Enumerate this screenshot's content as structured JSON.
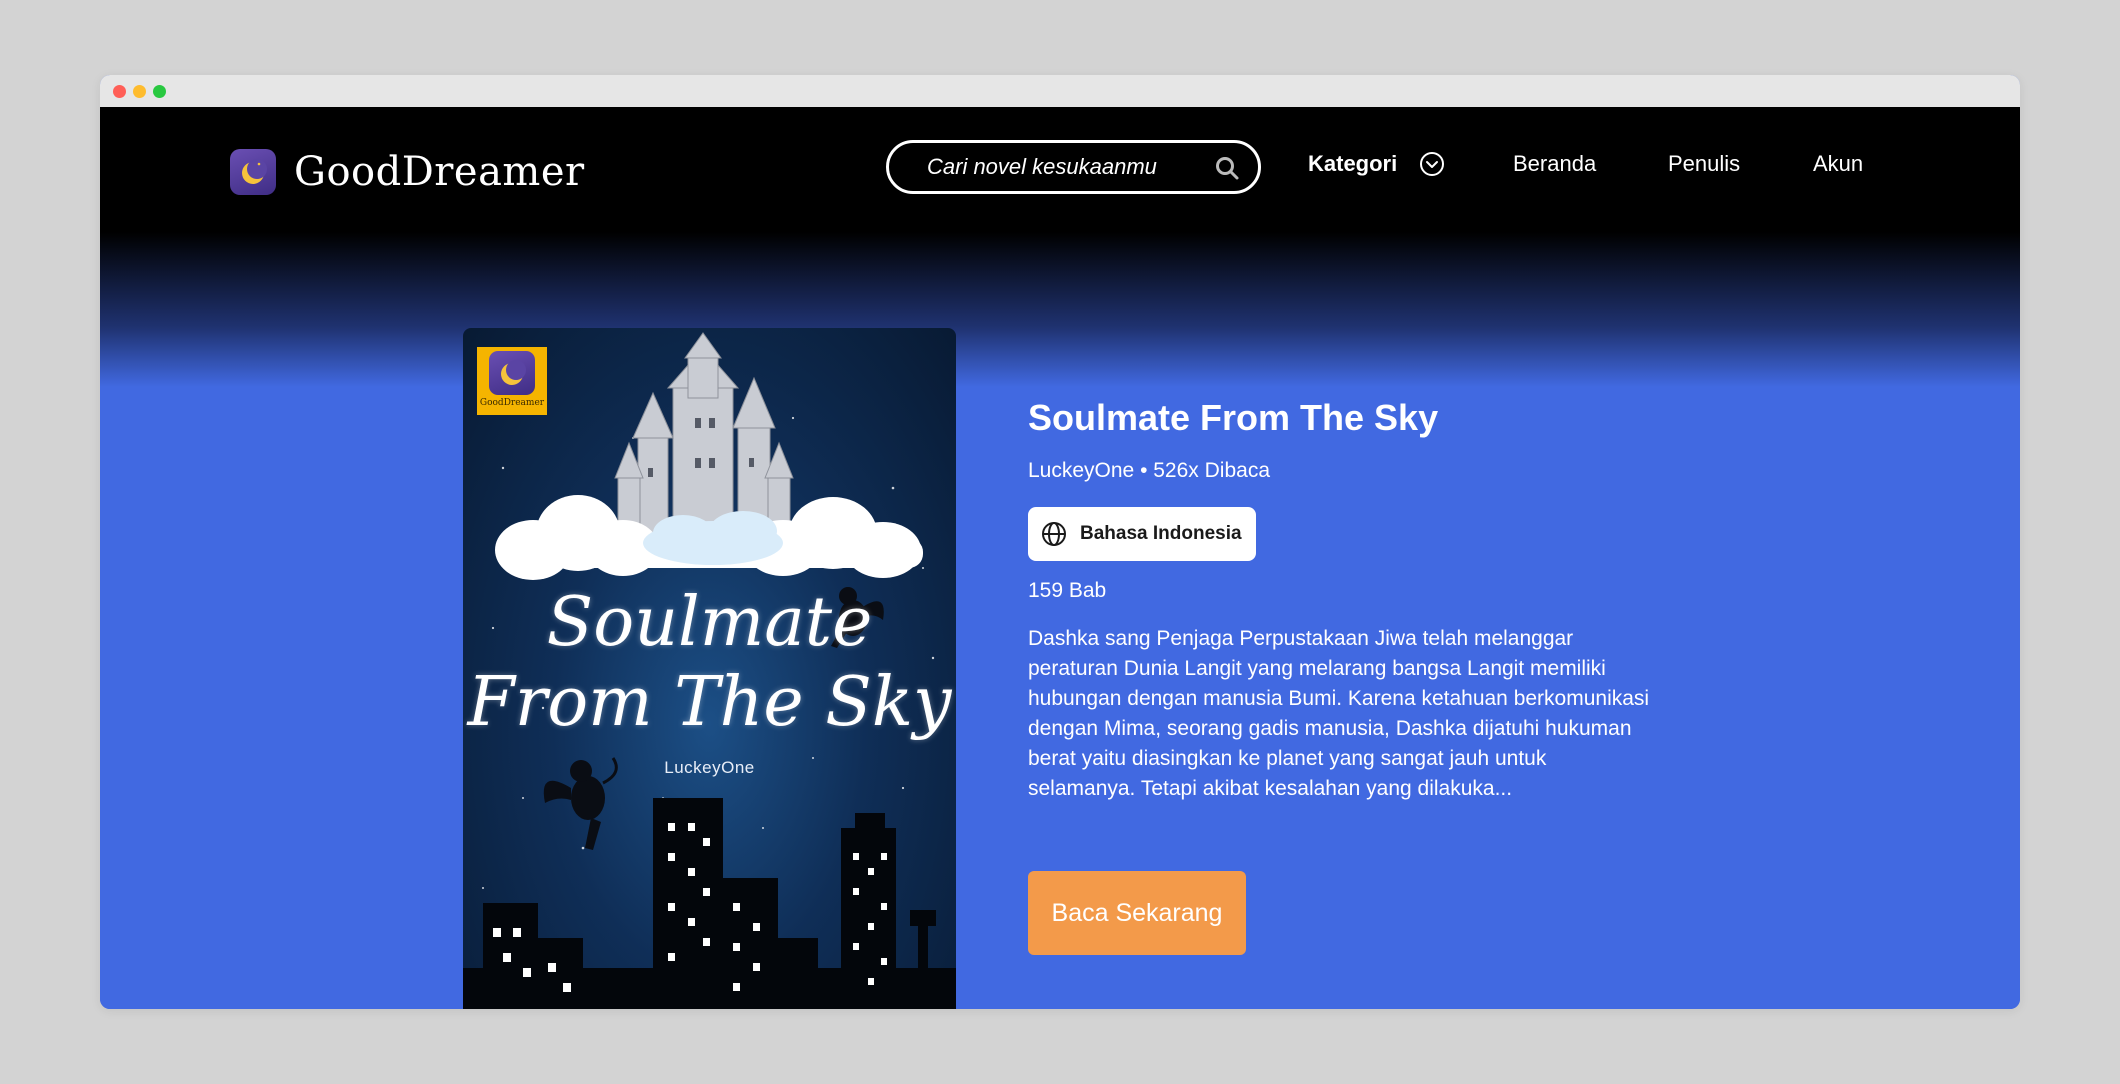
{
  "brand": {
    "name": "GoodDreamer",
    "badge_text": "GoodDreamer"
  },
  "search": {
    "placeholder": "Cari novel kesukaanmu"
  },
  "nav": {
    "kategori": "Kategori",
    "beranda": "Beranda",
    "penulis": "Penulis",
    "akun": "Akun"
  },
  "book": {
    "cover_title_line1": "Soulmate",
    "cover_title_line2": "From The Sky",
    "cover_author": "LuckeyOne",
    "title": "Soulmate From The Sky",
    "meta": "LuckeyOne • 526x Dibaca",
    "language": "Bahasa Indonesia",
    "chapters": "159 Bab",
    "synopsis": "Dashka sang Penjaga Perpustakaan Jiwa telah melanggar peraturan Dunia Langit yang melarang bangsa Langit memiliki hubungan dengan manusia Bumi. Karena ketahuan berkomunikasi dengan Mima, seorang gadis manusia, Dashka dijatuhi hukuman berat yaitu diasingkan ke planet yang sangat jauh untuk selamanya. Tetapi akibat kesalahan yang dilakuka...",
    "read_button": "Baca Sekarang"
  },
  "colors": {
    "accent": "#4169e1",
    "button": "#f39a4a",
    "header": "#000000"
  }
}
